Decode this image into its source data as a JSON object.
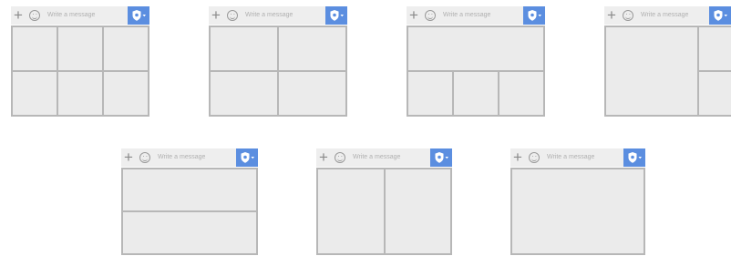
{
  "composer": {
    "placeholder": "Write a message",
    "add_icon": "plus-icon",
    "emoji_icon": "smiley-icon",
    "shield_icon": "shield-icon",
    "dropdown_icon": "chevron-down-icon",
    "accent_color": "#5b8ee0"
  },
  "layouts": [
    {
      "name": "six-grid",
      "cells": 6
    },
    {
      "name": "four-grid",
      "cells": 4
    },
    {
      "name": "one-top-three-bottom",
      "cells": 4
    },
    {
      "name": "one-left-two-right",
      "cells": 3
    },
    {
      "name": "two-rows",
      "cells": 2
    },
    {
      "name": "two-columns",
      "cells": 2
    },
    {
      "name": "single",
      "cells": 1
    }
  ]
}
